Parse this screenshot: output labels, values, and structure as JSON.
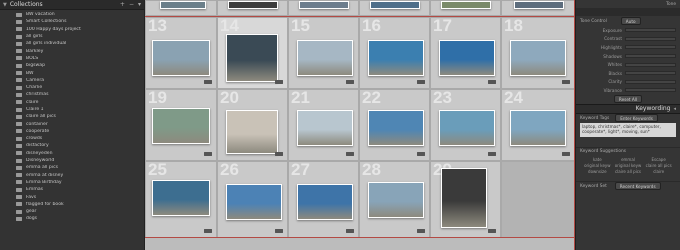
{
  "collections_panel": {
    "title": "Collections",
    "controls": [
      "+",
      "−",
      "▾"
    ],
    "items": [
      {
        "name": "BW vacation",
        "count": ""
      },
      {
        "name": "Smart Collections",
        "count": ""
      },
      {
        "name": "100 Happy days project",
        "count": ""
      },
      {
        "name": "all girls",
        "count": ""
      },
      {
        "name": "all girls individual",
        "count": ""
      },
      {
        "name": "Barkley",
        "count": ""
      },
      {
        "name": "BOLS",
        "count": ""
      },
      {
        "name": "bigswap",
        "count": ""
      },
      {
        "name": "BW",
        "count": ""
      },
      {
        "name": "Camera",
        "count": ""
      },
      {
        "name": "Charlie",
        "count": ""
      },
      {
        "name": "christmas",
        "count": ""
      },
      {
        "name": "claire",
        "count": ""
      },
      {
        "name": "Claire 1",
        "count": ""
      },
      {
        "name": "claire all pics",
        "count": ""
      },
      {
        "name": "container",
        "count": ""
      },
      {
        "name": "cooperate",
        "count": ""
      },
      {
        "name": "crowds",
        "count": ""
      },
      {
        "name": "disfactory",
        "count": ""
      },
      {
        "name": "disneyeden",
        "count": ""
      },
      {
        "name": "Disneyworld",
        "count": ""
      },
      {
        "name": "emma all pics",
        "count": ""
      },
      {
        "name": "emma at disney",
        "count": ""
      },
      {
        "name": "Emma Birthday",
        "count": ""
      },
      {
        "name": "Emmas",
        "count": ""
      },
      {
        "name": "Favs",
        "count": ""
      },
      {
        "name": "flagged for book",
        "count": ""
      },
      {
        "name": "gear",
        "count": ""
      },
      {
        "name": "dogs",
        "count": ""
      }
    ]
  },
  "grid": {
    "top_partial": [],
    "rows": [
      [
        "13",
        "14",
        "15",
        "16",
        "17",
        "18"
      ],
      [
        "19",
        "20",
        "21",
        "22",
        "23",
        "24"
      ],
      [
        "25",
        "26",
        "27",
        "28",
        "29",
        ""
      ]
    ]
  },
  "right_panel": {
    "top_label": "Tone",
    "tone_control_label": "Tone Control",
    "auto_button": "Auto",
    "sliders": [
      "Exposure",
      "Contrast",
      "Highlights",
      "Shadows",
      "Whites",
      "Blacks",
      "Clarity",
      "Vibrance"
    ],
    "reset_button": "Reset All",
    "keywording_title": "Keywording",
    "keyword_tags_label": "Keyword Tags",
    "keyword_tags_mode": "Enter Keywords",
    "keyword_text": "laptop, christmas*, claire*, computer, cooperate*, light*, moving, sun*",
    "suggestions_title": "Keyword Suggestions",
    "suggestions": [
      "kate",
      "emmal",
      "Escape",
      "original keyw",
      "original keyw",
      "claire all pics",
      "downsize",
      "claire all pics",
      "claire"
    ],
    "keyword_set_label": "Keyword Set",
    "keyword_set_value": "Recent Keywords"
  },
  "colors": {
    "accent_red": "#b34a44",
    "grid_bg": "#bcbcbc",
    "panel_bg": "#333333"
  }
}
